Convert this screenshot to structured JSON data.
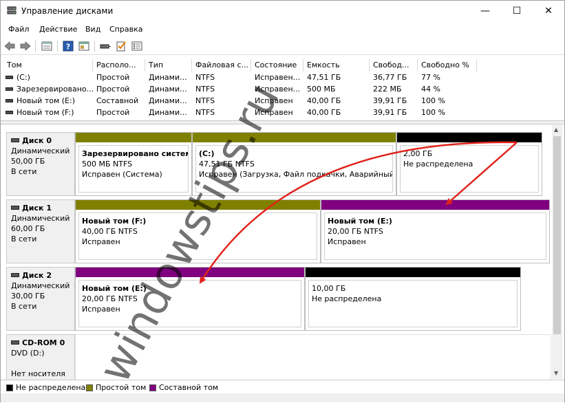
{
  "window": {
    "title": "Управление дисками",
    "minimize": "—",
    "maximize": "☐",
    "close": "✕"
  },
  "menu": [
    "Файл",
    "Действие",
    "Вид",
    "Справка"
  ],
  "volumes": {
    "headers": [
      "Том",
      "Располо...",
      "Тип",
      "Файловая с...",
      "Состояние",
      "Емкость",
      "Свобод...",
      "Свободно %"
    ],
    "rows": [
      [
        "(C:)",
        "Простой",
        "Динами...",
        "NTFS",
        "Исправен...",
        "47,51 ГБ",
        "36,77 ГБ",
        "77 %"
      ],
      [
        "Зарезервировано...",
        "Простой",
        "Динами...",
        "NTFS",
        "Исправен...",
        "500 МБ",
        "222 МБ",
        "44 %"
      ],
      [
        "Новый том (E:)",
        "Составной",
        "Динами...",
        "NTFS",
        "Исправен",
        "40,00 ГБ",
        "39,91 ГБ",
        "100 %"
      ],
      [
        "Новый том (F:)",
        "Простой",
        "Динами...",
        "NTFS",
        "Исправен",
        "40,00 ГБ",
        "39,91 ГБ",
        "100 %"
      ]
    ]
  },
  "disks": [
    {
      "name": "Диск 0",
      "type": "Динамический",
      "size": "50,00 ГБ",
      "status": "В сети",
      "partitions": [
        {
          "title": "Зарезервировано системо",
          "size": "500 МБ NTFS",
          "status": "Исправен (Система)",
          "kind": "simple"
        },
        {
          "title": "(C:)",
          "size": "47,51 ГБ NTFS",
          "status": "Исправен (Загрузка, Файл подкачки, Аварийный да",
          "kind": "simple"
        },
        {
          "title": "",
          "size": "2,00 ГБ",
          "status": "Не распределена",
          "kind": "unallocated"
        }
      ]
    },
    {
      "name": "Диск 1",
      "type": "Динамический",
      "size": "60,00 ГБ",
      "status": "В сети",
      "partitions": [
        {
          "title": "Новый том  (F:)",
          "size": "40,00 ГБ NTFS",
          "status": "Исправен",
          "kind": "simple"
        },
        {
          "title": "Новый том  (E:)",
          "size": "20,00 ГБ NTFS",
          "status": "Исправен",
          "kind": "spanned"
        }
      ]
    },
    {
      "name": "Диск 2",
      "type": "Динамический",
      "size": "30,00 ГБ",
      "status": "В сети",
      "partitions": [
        {
          "title": "Новый том  (E:)",
          "size": "20,00 ГБ NTFS",
          "status": "Исправен",
          "kind": "spanned"
        },
        {
          "title": "",
          "size": "10,00 ГБ",
          "status": "Не распределена",
          "kind": "unallocated"
        }
      ]
    },
    {
      "name": "CD-ROM 0",
      "type": "DVD (D:)",
      "size": "",
      "status": "Нет носителя",
      "partitions": []
    }
  ],
  "legend": [
    {
      "label": "Не распределена",
      "color": "#000000"
    },
    {
      "label": "Простой том",
      "color": "#808000"
    },
    {
      "label": "Составной том",
      "color": "#800080"
    }
  ],
  "colors": {
    "simple": "#808000",
    "spanned": "#800080",
    "unallocated": "#000000",
    "arrow": "#e0231b"
  },
  "watermark": "windowstips.ru"
}
